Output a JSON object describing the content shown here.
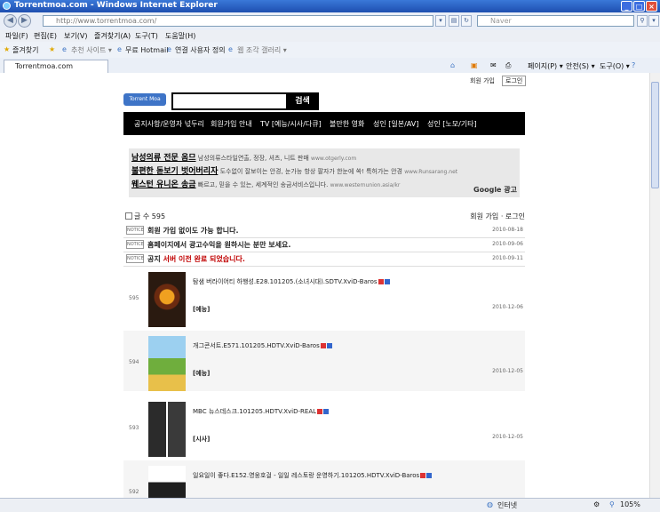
{
  "window": {
    "title": "Torrentmoa.com - Windows Internet Explorer"
  },
  "address": {
    "url": "http://www.torrentmoa.com/",
    "search_placeholder": "Naver"
  },
  "menu": [
    "파일(F)",
    "편집(E)",
    "보기(V)",
    "즐겨찾기(A)",
    "도구(T)",
    "도움말(H)"
  ],
  "favorites": {
    "label": "즐겨찾기",
    "items": [
      "추천 사이트 ▾",
      "무료 Hotmail",
      "연결 사용자 정의",
      "웹 조각 갤러리 ▾"
    ]
  },
  "tab": {
    "title": "Torrentmoa.com"
  },
  "commandbar": [
    "페이지(P) ▾",
    "안전(S) ▾",
    "도구(O) ▾"
  ],
  "page": {
    "top_links": {
      "join": "회원 가입",
      "login": "로그인"
    },
    "logo": "Torrent Moa",
    "search_button": "검색",
    "nav": [
      "공지사항/운영자 넋두리",
      "회원가입 안내",
      "TV [예능/시사/다큐]",
      "볼만한 영화",
      "성인 [일본/AV]",
      "성인 [노모/기타]"
    ],
    "ads": [
      {
        "title": "남성의류 전문 옴므",
        "desc": "남성의류스타일연출, 정장, 셔츠, 니트 판매",
        "url": "www.otgerly.com"
      },
      {
        "title": "불편한 돋보기 벗어버리자",
        "desc": "도수없이 잘보이는 안경, 눈가능 항상 팔자가 한눈에 쏙! 특허가는 안경",
        "url": "www.Runsarang.net"
      },
      {
        "title": "웨스턴 유니온 송금",
        "desc": "빠르고, 믿을 수 있는, 세계적인 송금서비스입니다.",
        "url": "www.westernunion.asia/kr"
      }
    ],
    "ads_label": "Google 광고",
    "count_label": "글 수 595",
    "member_links": "회원 가입 · 로그인",
    "notices": [
      {
        "tag": "NOTICE",
        "text": "회원 가입 없이도 가능 합니다.",
        "date": "2010-08-18"
      },
      {
        "tag": "NOTICE",
        "text": "홈페이지에서 광고수익을 원하시는 분만 보세요.",
        "date": "2010-09-06"
      },
      {
        "tag": "NOTICE",
        "prefix": "공지",
        "text": "서버 이전 완료 되었습니다.",
        "date": "2010-09-11"
      }
    ],
    "posts": [
      {
        "num": "595",
        "title": "탐샘 버라이어티 하행성.E28.101205.(소녀시대).SDTV.XviD-Baros",
        "category": "[예능]",
        "date": "2010-12-06"
      },
      {
        "num": "594",
        "title": "개그콘서트.E571.101205.HDTV.XviD-Baros",
        "category": "[예능]",
        "date": "2010-12-05"
      },
      {
        "num": "593",
        "title": "MBC 뉴스데스크.101205.HDTV.XviD-REAL",
        "category": "[시사]",
        "date": "2010-12-05"
      },
      {
        "num": "592",
        "title": "일요일이 좋다.E152.영웅호걸 - 일일 레스토랑 운영하기.101205.HDTV.XviD-Baros",
        "category": "",
        "date": ""
      }
    ]
  },
  "status": {
    "zone": "인터넷",
    "zoom": "105%"
  }
}
